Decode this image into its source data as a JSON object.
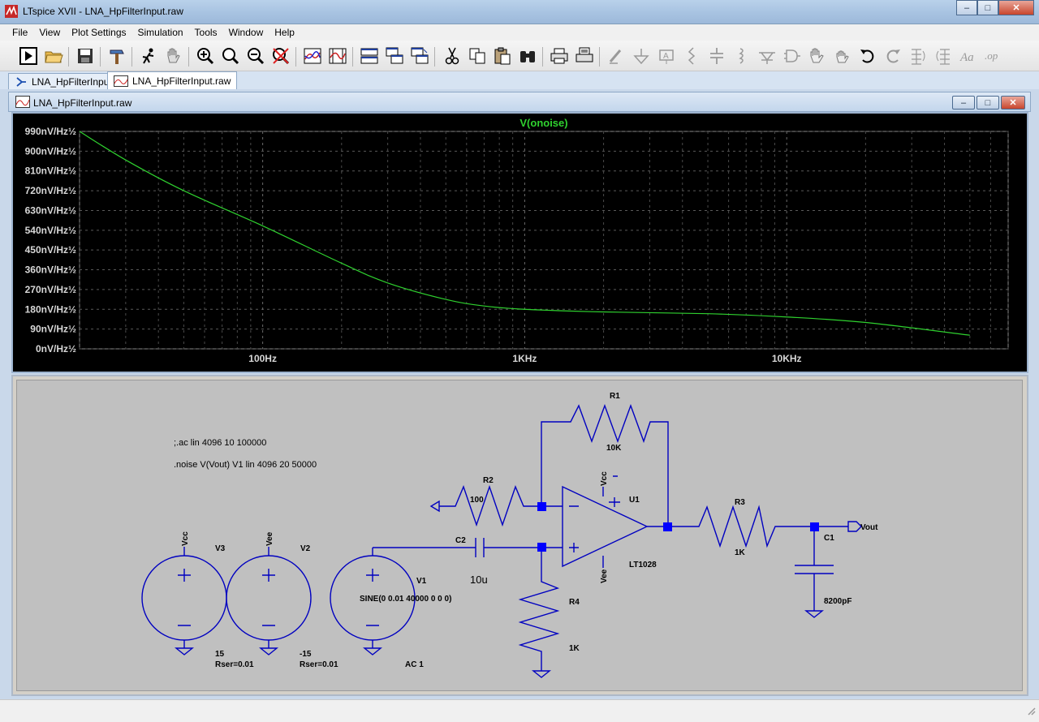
{
  "app": {
    "title": "LTspice XVII - LNA_HpFilterInput.raw"
  },
  "window_controls": {
    "minimize": "–",
    "maximize": "□",
    "close": "✕"
  },
  "menu": [
    "File",
    "View",
    "Plot Settings",
    "Simulation",
    "Tools",
    "Window",
    "Help"
  ],
  "toolbar_icons": [
    "run-icon",
    "open-icon",
    "save-icon",
    "hammer-icon",
    "probe-icon",
    "pan-hand-icon",
    "zoom-in-icon",
    "zoom-area-icon",
    "zoom-out-icon",
    "zoom-fit-icon",
    "autorange-icon",
    "markers-icon",
    "tile-horizontal-icon",
    "cascade-icon",
    "tile-vertical-icon",
    "cut-icon",
    "copy-icon",
    "paste-icon",
    "find-icon",
    "print-icon",
    "print-preview-icon",
    "wire-icon",
    "ground-icon",
    "label-icon",
    "resistor-icon",
    "capacitor-icon",
    "inductor-icon",
    "diode-icon",
    "component-icon",
    "move-hand-icon",
    "drag-hand-icon",
    "undo-icon",
    "redo-icon",
    "rotate-icon",
    "mirror-icon",
    "text-icon",
    "spice-directive-icon"
  ],
  "tabs": [
    {
      "label": "LNA_HpFilterInput",
      "icon": "schematic-icon"
    },
    {
      "label": "LNA_HpFilterInput.raw",
      "icon": "waveform-icon"
    }
  ],
  "plot_window": {
    "title": "LNA_HpFilterInput.raw"
  },
  "chart_data": {
    "type": "line",
    "title": "V(onoise)",
    "xscale": "log",
    "xlim": [
      20,
      70000
    ],
    "ylim": [
      0,
      990
    ],
    "grid": true,
    "y_ticks": [
      "990nV/Hz½",
      "900nV/Hz½",
      "810nV/Hz½",
      "720nV/Hz½",
      "630nV/Hz½",
      "540nV/Hz½",
      "450nV/Hz½",
      "360nV/Hz½",
      "270nV/Hz½",
      "180nV/Hz½",
      "90nV/Hz½",
      "0nV/Hz½"
    ],
    "y_tick_values": [
      990,
      900,
      810,
      720,
      630,
      540,
      450,
      360,
      270,
      180,
      90,
      0
    ],
    "x_ticks": [
      "100Hz",
      "1KHz",
      "10KHz"
    ],
    "x_tick_values": [
      100,
      1000,
      10000
    ],
    "series": [
      {
        "name": "V(onoise)",
        "color": "#2fd12f",
        "x": [
          20,
          30,
          50,
          100,
          200,
          300,
          500,
          700,
          1000,
          2000,
          5000,
          10000,
          20000,
          50000
        ],
        "y": [
          990,
          860,
          720,
          560,
          390,
          300,
          225,
          195,
          180,
          168,
          160,
          145,
          120,
          62
        ]
      }
    ]
  },
  "schematic": {
    "directives": [
      ";.ac lin 4096 10 100000",
      ".noise V(Vout) V1 lin 4096 20 50000"
    ],
    "components": {
      "R1": {
        "name": "R1",
        "value": "10K"
      },
      "R2": {
        "name": "R2",
        "value": "100"
      },
      "R3": {
        "name": "R3",
        "value": "1K"
      },
      "R4": {
        "name": "R4",
        "value": "1K"
      },
      "C1": {
        "name": "C1",
        "value": "8200pF"
      },
      "C2": {
        "name": "C2",
        "value": "10u"
      },
      "U1": {
        "name": "U1",
        "value": "LT1028"
      },
      "V1": {
        "name": "V1",
        "value": "SINE(0 0.01 40000 0 0 0)",
        "ac": "AC 1"
      },
      "V2": {
        "name": "V2",
        "value": "-15",
        "rser": "Rser=0.01"
      },
      "V3": {
        "name": "V3",
        "value": "15",
        "rser": "Rser=0.01"
      }
    },
    "net_labels": {
      "vcc": "Vcc",
      "vee": "Vee",
      "vout": "Vout"
    }
  },
  "colors": {
    "trace": "#2fd12f",
    "wire": "#0000c0",
    "junction": "#0000ff",
    "plot_bg": "#000000",
    "grid": "#5a5a5a",
    "schematic_bg": "#c0c0c0"
  }
}
